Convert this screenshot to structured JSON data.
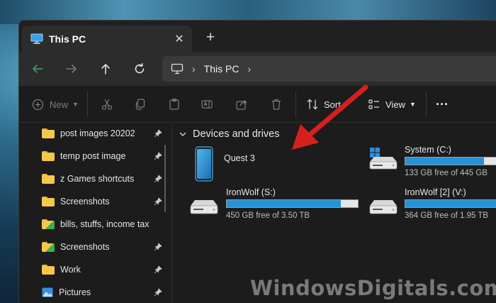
{
  "window": {
    "tab_title": "This PC",
    "new_tab_label": "+",
    "close_label": "✕"
  },
  "address": {
    "location": "This PC",
    "separator": "›"
  },
  "toolbar": {
    "new_label": "New",
    "sort_label": "Sort",
    "view_label": "View",
    "more_label": "···"
  },
  "sidebar": {
    "items": [
      {
        "label": "post images 20202",
        "icon": "folder-icon"
      },
      {
        "label": "temp post image",
        "icon": "folder-icon"
      },
      {
        "label": "z Games shortcuts",
        "icon": "folder-icon"
      },
      {
        "label": "Screenshots",
        "icon": "folder-icon"
      },
      {
        "label": "bills, stuffs, income tax",
        "icon": "folder-icon"
      },
      {
        "label": "Screenshots",
        "icon": "folder-icon"
      },
      {
        "label": "Work",
        "icon": "folder-icon"
      },
      {
        "label": "Pictures",
        "icon": "pictures-icon"
      }
    ]
  },
  "main": {
    "group_title": "Devices and drives",
    "drives": [
      {
        "name": "Quest 3",
        "icon": "phone-device-icon"
      },
      {
        "name": "System (C:)",
        "free_text": "133 GB free of 445 GB",
        "used_fraction": 0.7,
        "icon": "windows-drive-icon"
      },
      {
        "name": "IronWolf (S:)",
        "free_text": "450 GB free of 3.50 TB",
        "used_fraction": 0.87,
        "icon": "hard-drive-icon"
      },
      {
        "name": "IronWolf [2] (V:)",
        "free_text": "364 GB free of 1.95 TB",
        "used_fraction": 0.82,
        "icon": "hard-drive-icon"
      }
    ]
  },
  "watermark": {
    "text": "WindowsDigitals.com"
  },
  "colors": {
    "accent": "#2692d8",
    "arrow": "#d6201e",
    "folder": "#f5c84c",
    "window_bg": "#1c1c1c"
  }
}
